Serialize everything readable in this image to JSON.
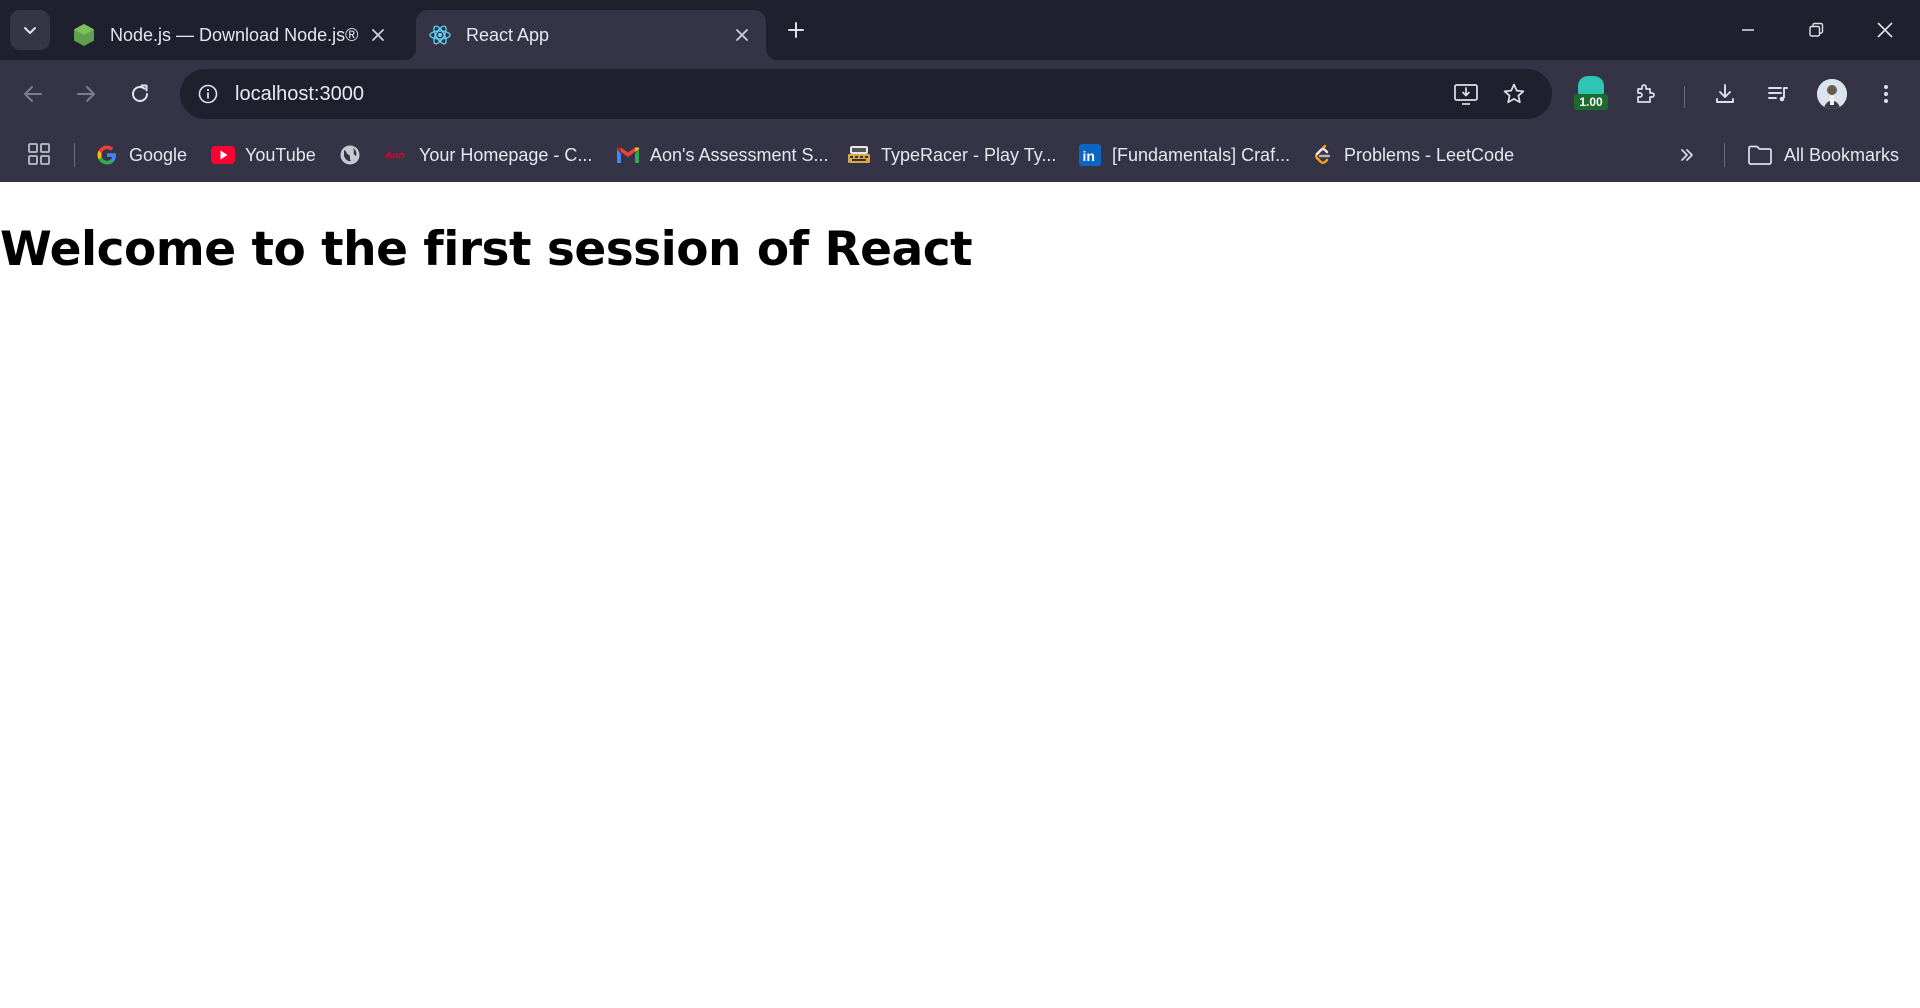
{
  "browser": {
    "tabs": [
      {
        "title": "Node.js — Download Node.js®",
        "favicon": "nodejs-icon",
        "active": false
      },
      {
        "title": "React App",
        "favicon": "react-icon",
        "active": true
      }
    ],
    "address_bar": {
      "url": "localhost:3000"
    },
    "extension_badge": "1.00",
    "bookmarks": [
      {
        "label": "Google",
        "icon": "google-icon"
      },
      {
        "label": "YouTube",
        "icon": "youtube-icon"
      },
      {
        "label": "",
        "icon": "globe-icon"
      },
      {
        "label": "Your Homepage - C...",
        "icon": "aon-icon"
      },
      {
        "label": "Aon's Assessment S...",
        "icon": "gmail-icon"
      },
      {
        "label": "TypeRacer - Play Ty...",
        "icon": "typeracer-icon"
      },
      {
        "label": "[Fundamentals] Craf...",
        "icon": "linkedin-icon"
      },
      {
        "label": "Problems - LeetCode",
        "icon": "leetcode-icon"
      }
    ],
    "all_bookmarks_label": "All Bookmarks",
    "colors": {
      "frame": "#1f1f2e",
      "toolbar": "#343446",
      "text": "#e6e6ee"
    }
  },
  "page": {
    "heading": "Welcome to the first session of React"
  }
}
